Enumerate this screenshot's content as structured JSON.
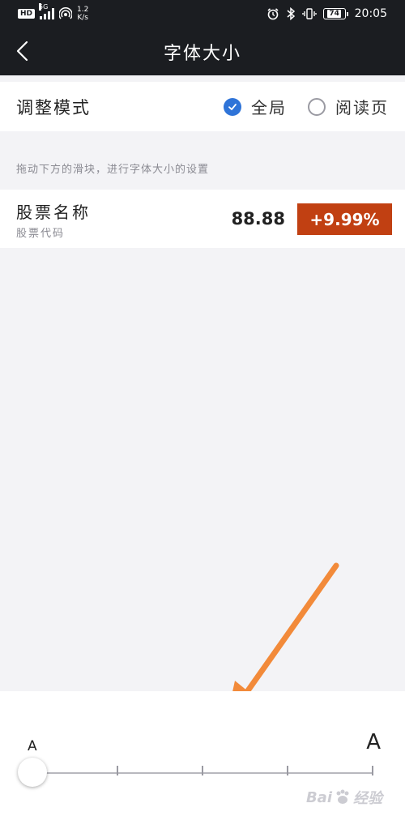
{
  "status_bar": {
    "hd_label": "HD",
    "network": "5G",
    "speed_value": "1.2",
    "speed_unit": "K/s",
    "battery": "74",
    "time": "20:05"
  },
  "nav": {
    "title": "字体大小",
    "back_icon": "chevron-left-icon"
  },
  "mode": {
    "label": "调整模式",
    "options": [
      {
        "label": "全局",
        "selected": true
      },
      {
        "label": "阅读页",
        "selected": false
      }
    ]
  },
  "hint": "拖动下方的滑块，进行字体大小的设置",
  "preview": {
    "name": "股票名称",
    "code": "股票代码",
    "price": "88.88",
    "change": "+9.99%"
  },
  "slider": {
    "min_label": "A",
    "max_label": "A",
    "steps": 5,
    "current_index": 0
  },
  "watermark": {
    "left": "Bai",
    "right": "经验"
  },
  "colors": {
    "header_bg": "#1b1d21",
    "accent_blue": "#2f74d8",
    "change_bg": "#c14012",
    "annotation_arrow": "#f28a3a"
  }
}
